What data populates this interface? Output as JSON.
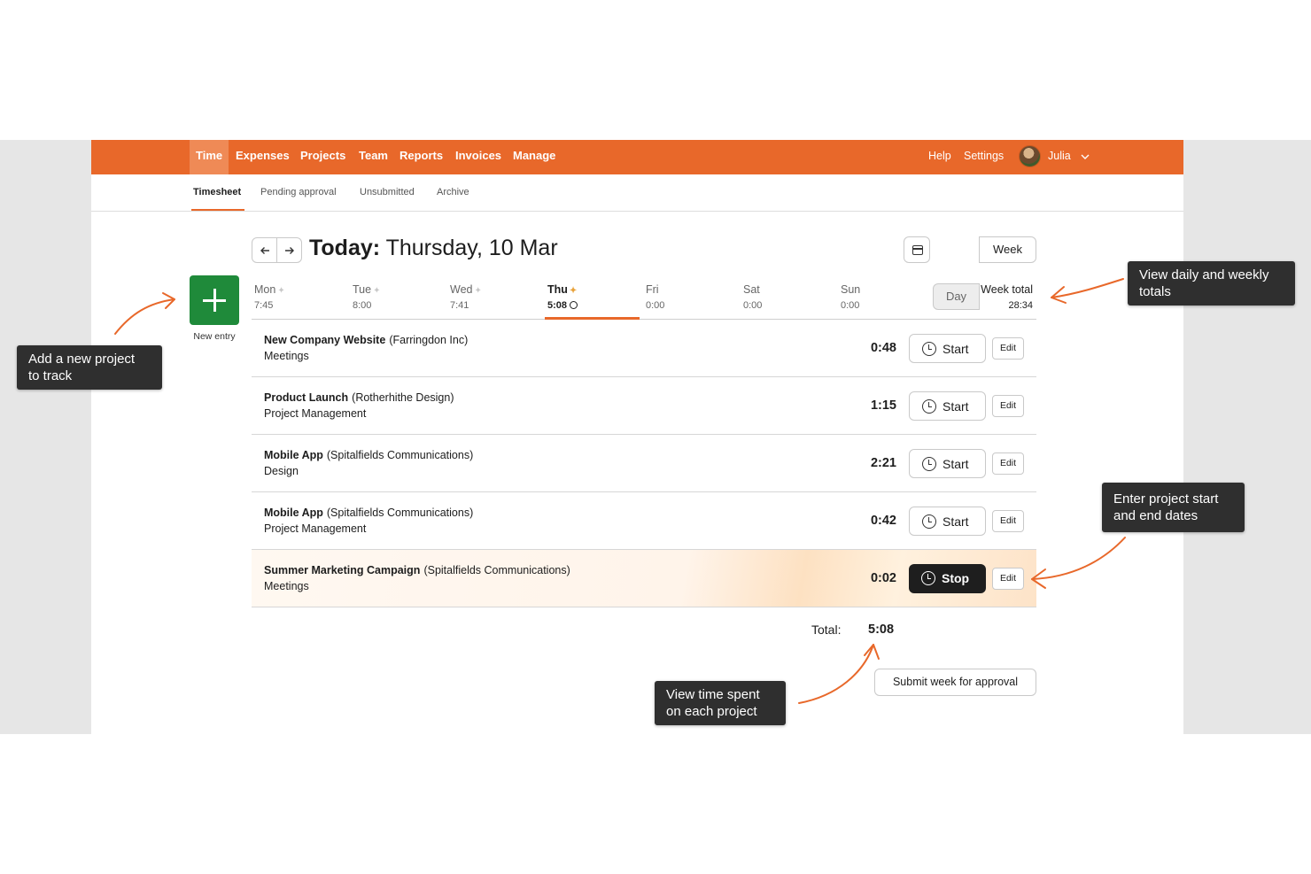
{
  "nav": {
    "items": [
      "Time",
      "Expenses",
      "Projects",
      "Team",
      "Reports",
      "Invoices",
      "Manage"
    ],
    "active": "Time",
    "help": "Help",
    "settings": "Settings",
    "user": "Julia"
  },
  "subnav": {
    "items": [
      "Timesheet",
      "Pending approval",
      "Unsubmitted",
      "Archive"
    ],
    "active": "Timesheet"
  },
  "header": {
    "prefix": "Today:",
    "date": "Thursday, 10 Mar",
    "view_day": "Day",
    "view_week": "Week",
    "active_view": "Day"
  },
  "new_entry": {
    "label": "New entry",
    "color": "#1f8a3a"
  },
  "days": [
    {
      "name": "Mon",
      "time": "7:45"
    },
    {
      "name": "Tue",
      "time": "8:00"
    },
    {
      "name": "Wed",
      "time": "7:41"
    },
    {
      "name": "Thu",
      "time": "5:08",
      "today": true
    },
    {
      "name": "Fri",
      "time": "0:00"
    },
    {
      "name": "Sat",
      "time": "0:00"
    },
    {
      "name": "Sun",
      "time": "0:00"
    }
  ],
  "week_total": {
    "label": "Week total",
    "value": "28:34"
  },
  "entries": [
    {
      "project": "New Company Website",
      "client": "(Farringdon Inc)",
      "task": "Meetings",
      "duration": "0:48",
      "action": "Start",
      "edit": "Edit"
    },
    {
      "project": "Product Launch",
      "client": "(Rotherhithe Design)",
      "task": "Project Management",
      "duration": "1:15",
      "action": "Start",
      "edit": "Edit"
    },
    {
      "project": "Mobile App",
      "client": "(Spitalfields Communications)",
      "task": "Design",
      "duration": "2:21",
      "action": "Start",
      "edit": "Edit"
    },
    {
      "project": "Mobile App",
      "client": "(Spitalfields Communications)",
      "task": "Project Management",
      "duration": "0:42",
      "action": "Start",
      "edit": "Edit"
    },
    {
      "project": "Summer Marketing Campaign",
      "client": "(Spitalfields Communications)",
      "task": "Meetings",
      "duration": "0:02",
      "action": "Stop",
      "edit": "Edit",
      "running": true
    }
  ],
  "total": {
    "label": "Total:",
    "value": "5:08"
  },
  "submit": "Submit week for approval",
  "callouts": {
    "new_project_line1": "Add a new project",
    "new_project_line2": "to track",
    "totals_line1": "View daily and weekly",
    "totals_line2": "totals",
    "dates_line1": "Enter project start",
    "dates_line2": "and end dates",
    "time_spent_line1": "View time spent",
    "time_spent_line2": "on each project"
  },
  "colors": {
    "brand": "#e8682a",
    "nav_active": "#ef8a56",
    "callout_bg": "#2f2f2f",
    "stop_bg": "#1e1e1e"
  },
  "icons": [
    "arrow-left-icon",
    "arrow-right-icon",
    "calendar-icon",
    "plus-icon",
    "clock-icon",
    "sparkle-icon",
    "chevron-down-icon"
  ]
}
